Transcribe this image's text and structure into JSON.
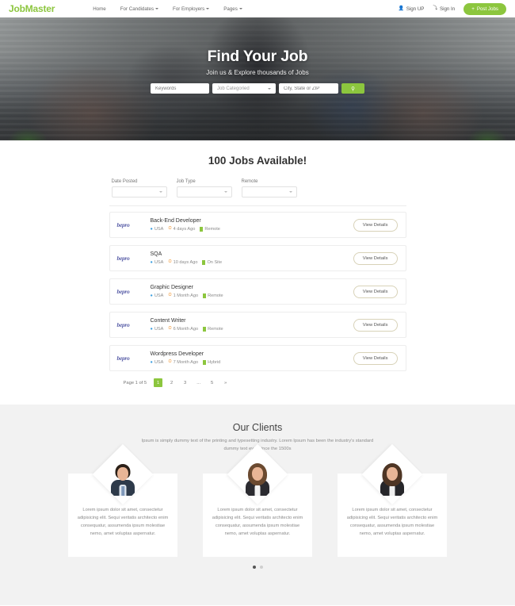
{
  "header": {
    "logo": "JobMaster",
    "nav": [
      {
        "label": "Home",
        "has_caret": false
      },
      {
        "label": "For Candidates",
        "has_caret": true
      },
      {
        "label": "For Employers",
        "has_caret": true
      },
      {
        "label": "Pages",
        "has_caret": true
      }
    ],
    "sign_up": "Sign UP",
    "sign_in": "Sign In",
    "post_jobs": "Post Jobs",
    "accent_color": "#8cc63e"
  },
  "hero": {
    "title": "Find Your Job",
    "subtitle": "Join us & Explore thousands of Jobs",
    "keywords_placeholder": "Keywords",
    "category_placeholder": "Job Categoried",
    "city_placeholder": "City, State or ZIP",
    "search_icon": "⌕"
  },
  "jobs": {
    "title": "100 Jobs Available!",
    "filters": [
      {
        "label": "Date Posted",
        "value": ""
      },
      {
        "label": "Job Type",
        "value": ""
      },
      {
        "label": "Remote",
        "value": ""
      }
    ],
    "view_details_label": "View Details",
    "company_logo": "bepro",
    "listings": [
      {
        "title": "Back-End Developer",
        "location": "USA",
        "posted": "4 days Ago",
        "work_type": "Remote"
      },
      {
        "title": "SQA",
        "location": "USA",
        "posted": "10 days Ago",
        "work_type": "On Site"
      },
      {
        "title": "Graphic Designer",
        "location": "USA",
        "posted": "1 Month Ago",
        "work_type": "Remote"
      },
      {
        "title": "Content Writer",
        "location": "USA",
        "posted": "6 Month Ago",
        "work_type": "Remote"
      },
      {
        "title": "Wordpress Developer",
        "location": "USA",
        "posted": "7 Month Ago",
        "work_type": "Hybrid"
      }
    ]
  },
  "pagination": {
    "status": "Page 1 of 5",
    "pages": [
      "1",
      "2",
      "3",
      "...",
      "5",
      "»"
    ],
    "active_index": 0
  },
  "clients": {
    "title": "Our Clients",
    "subtitle": "Ipsum is simply dummy text of the printing and typesetting industry. Lorem Ipsum has been the industry's standard dummy text ever since the 1500s",
    "testimonials": [
      {
        "text": "Lorem ipsum dolor sit amet, consectetur adipisicing elit. Sequi veritatis architecto enim consequatur, assumenda ipsum molestiae nemo, amet voluptas aspernatur.",
        "avatar": "male"
      },
      {
        "text": "Lorem ipsum dolor sit amet, consectetur adipisicing elit. Sequi veritatis architecto enim consequatur, assumenda ipsum molestiae nemo, amet voluptas aspernatur.",
        "avatar": "female-1"
      },
      {
        "text": "Lorem ipsum dolor sit amet, consectetur adipisicing elit. Sequi veritatis architecto enim consequatur, assumenda ipsum molestiae nemo, amet voluptas aspernatur.",
        "avatar": "female-2"
      }
    ],
    "dots": 2,
    "active_dot": 0
  }
}
